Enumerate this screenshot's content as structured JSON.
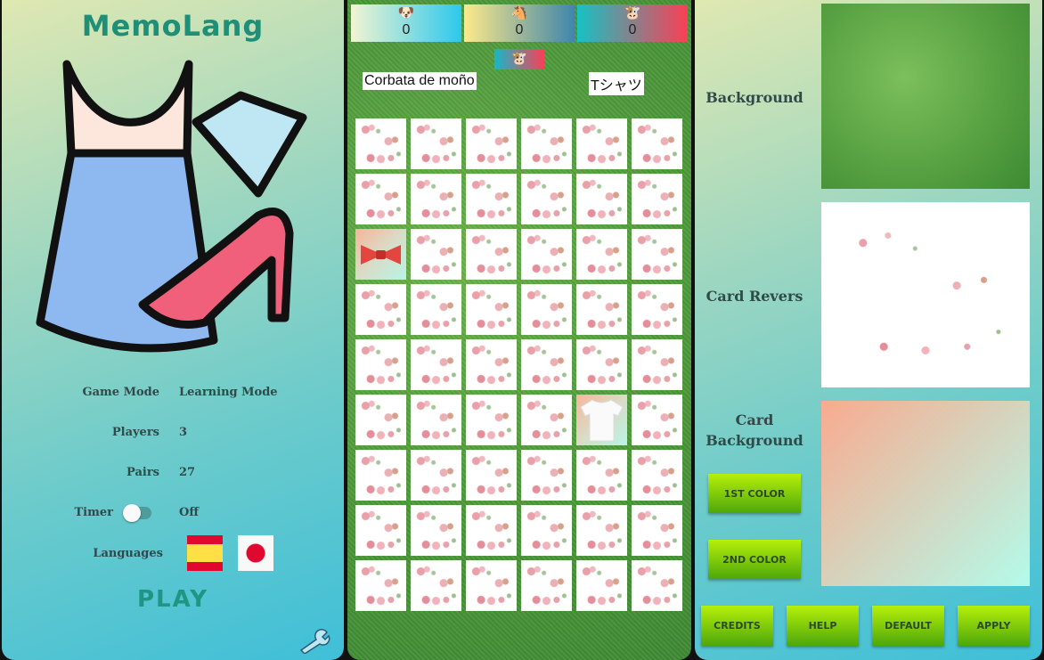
{
  "app": {
    "title": "MemoLang",
    "play_label": "PLAY"
  },
  "settings": {
    "game_mode": {
      "label": "Game Mode",
      "value": "Learning Mode"
    },
    "players": {
      "label": "Players",
      "value": "3"
    },
    "pairs": {
      "label": "Pairs",
      "value": "27"
    },
    "timer": {
      "label": "Timer",
      "value": "Off",
      "enabled": false
    },
    "languages": {
      "label": "Languages",
      "items": [
        "Spanish flag",
        "Japanese flag"
      ]
    }
  },
  "game": {
    "scores": [
      {
        "icon": "🐶",
        "value": "0"
      },
      {
        "icon": "🐴",
        "value": "0"
      },
      {
        "icon": "🐮",
        "value": "0"
      }
    ],
    "current_player_icon": "🐮",
    "word_left": "Corbata de moño",
    "word_right": "Tシャツ",
    "columns": 6,
    "cards": [
      "reverse",
      "reverse",
      "reverse",
      "reverse",
      "reverse",
      "reverse",
      "reverse",
      "reverse",
      "reverse",
      "reverse",
      "reverse",
      "reverse",
      "bow-tie",
      "reverse",
      "reverse",
      "reverse",
      "reverse",
      "reverse",
      "reverse",
      "reverse",
      "reverse",
      "reverse",
      "reverse",
      "reverse",
      "reverse",
      "reverse",
      "reverse",
      "reverse",
      "reverse",
      "reverse",
      "reverse",
      "reverse",
      "reverse",
      "reverse",
      "t-shirt",
      "reverse",
      "reverse",
      "reverse",
      "reverse",
      "reverse",
      "reverse",
      "reverse",
      "reverse",
      "reverse",
      "reverse",
      "reverse",
      "reverse",
      "reverse",
      "reverse",
      "reverse",
      "reverse",
      "reverse",
      "reverse",
      "reverse"
    ]
  },
  "customize": {
    "background_label": "Background",
    "card_reverse_label": "Card Revers",
    "card_background_label": "Card Background",
    "first_color": "1ST COLOR",
    "second_color": "2ND COLOR",
    "colors": {
      "first": "#f9ab8f",
      "second": "#b3fbea"
    },
    "buttons": [
      "CREDITS",
      "HELP",
      "DEFAULT",
      "APPLY"
    ]
  }
}
